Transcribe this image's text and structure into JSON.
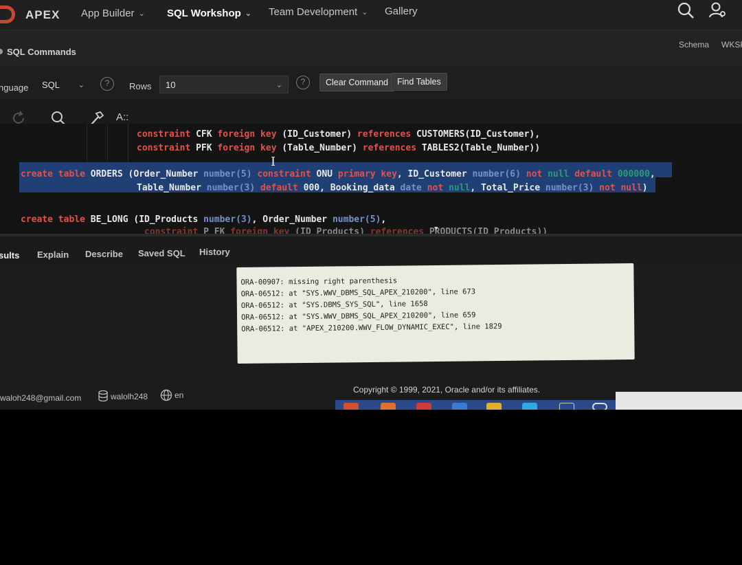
{
  "topnav": {
    "brand": "APEX",
    "items": [
      {
        "label": "App Builder"
      },
      {
        "label": "SQL Workshop"
      },
      {
        "label": "Team Development"
      },
      {
        "label": "Gallery"
      }
    ]
  },
  "breadcrumb": {
    "title": "SQL Commands",
    "schema_label": "Schema",
    "schema_value": "WKSP"
  },
  "toolbar": {
    "language_label": "nguage",
    "language_value": "SQL",
    "rows_label": "Rows",
    "rows_value": "10",
    "clear_command": "Clear Command",
    "find_tables": "Find Tables"
  },
  "editor": {
    "az_label": "A::",
    "lines": [
      "constraint CFK foreign key (ID_Customer) references CUSTOMERS(ID_Customer),",
      "constraint PFK foreign key (Table_Number) references TABLES2(Table_Number))",
      "create table ORDERS (Order_Number number(5) constraint ONU primary key, ID_Customer number(6) not null default 000000,",
      "Table_Number number(3) default 000, Booking_data date not null, Total_Price number(3) not null)",
      "create table BE_LONG (ID_Products number(3), Order_Number number(5),",
      "constraint P_FK foreign key (ID_Products) references PRODUCTS(ID_Products))"
    ]
  },
  "tabs": [
    {
      "label": "sults"
    },
    {
      "label": "Explain"
    },
    {
      "label": "Describe"
    },
    {
      "label": "Saved SQL"
    },
    {
      "label": "History"
    }
  ],
  "error": {
    "lines": [
      "ORA-00907: missing right parenthesis",
      "ORA-06512: at \"SYS.WWV_DBMS_SQL_APEX_210200\", line 673",
      "ORA-06512: at \"SYS.DBMS_SYS_SQL\", line 1658",
      "ORA-06512: at \"SYS.WWV_DBMS_SQL_APEX_210200\", line 659",
      "ORA-06512: at \"APEX_210200.WWV_FLOW_DYNAMIC_EXEC\", line 1829"
    ]
  },
  "footer": {
    "email": "waloh248@gmail.com",
    "workspace": "walolh248",
    "language": "en",
    "copyright": "Copyright © 1999, 2021, Oracle and/or its affiliates."
  },
  "colors": {
    "keyword": "#e0524c",
    "type": "#7a8fc9",
    "number": "#2c9a7a",
    "selection": "#1f3f75",
    "brand_red": "#c74634"
  }
}
